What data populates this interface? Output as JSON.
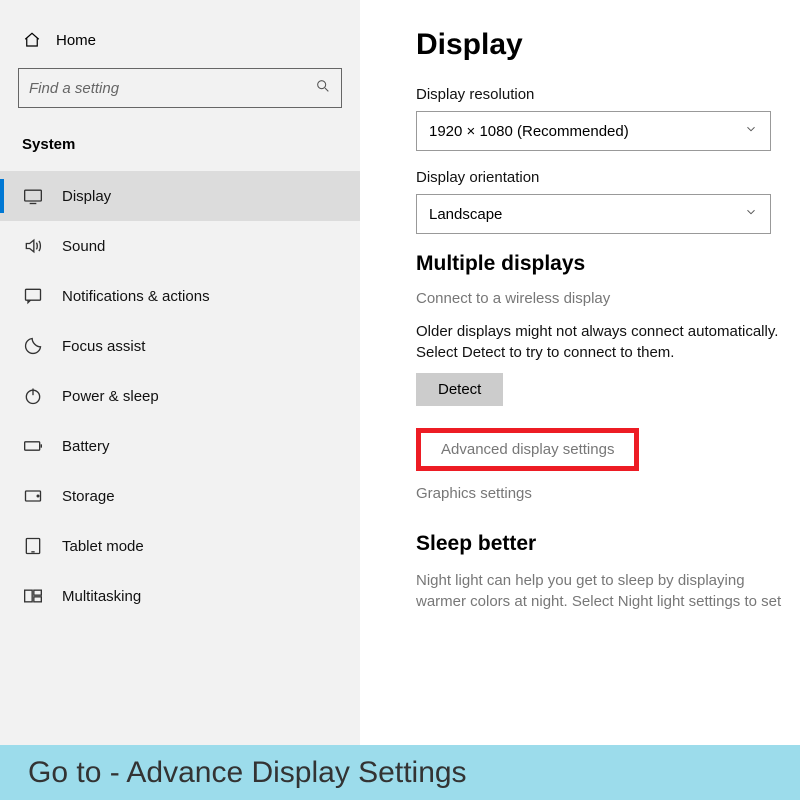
{
  "sidebar": {
    "home": "Home",
    "search_placeholder": "Find a setting",
    "section": "System",
    "items": [
      {
        "label": "Display",
        "selected": true
      },
      {
        "label": "Sound"
      },
      {
        "label": "Notifications & actions"
      },
      {
        "label": "Focus assist"
      },
      {
        "label": "Power & sleep"
      },
      {
        "label": "Battery"
      },
      {
        "label": "Storage"
      },
      {
        "label": "Tablet mode"
      },
      {
        "label": "Multitasking"
      }
    ]
  },
  "main": {
    "title": "Display",
    "resolution_label": "Display resolution",
    "resolution_value": "1920 × 1080 (Recommended)",
    "orientation_label": "Display orientation",
    "orientation_value": "Landscape",
    "multiple_heading": "Multiple displays",
    "wireless_link": "Connect to a wireless display",
    "older_displays_text": "Older displays might not always connect automatically. Select Detect to try to connect to them.",
    "detect_button": "Detect",
    "advanced_link": "Advanced display settings",
    "graphics_link": "Graphics settings",
    "sleep_heading": "Sleep better",
    "sleep_text": "Night light can help you get to sleep by displaying warmer colors at night. Select Night light settings to set"
  },
  "banner": "Go to - Advance Display Settings"
}
